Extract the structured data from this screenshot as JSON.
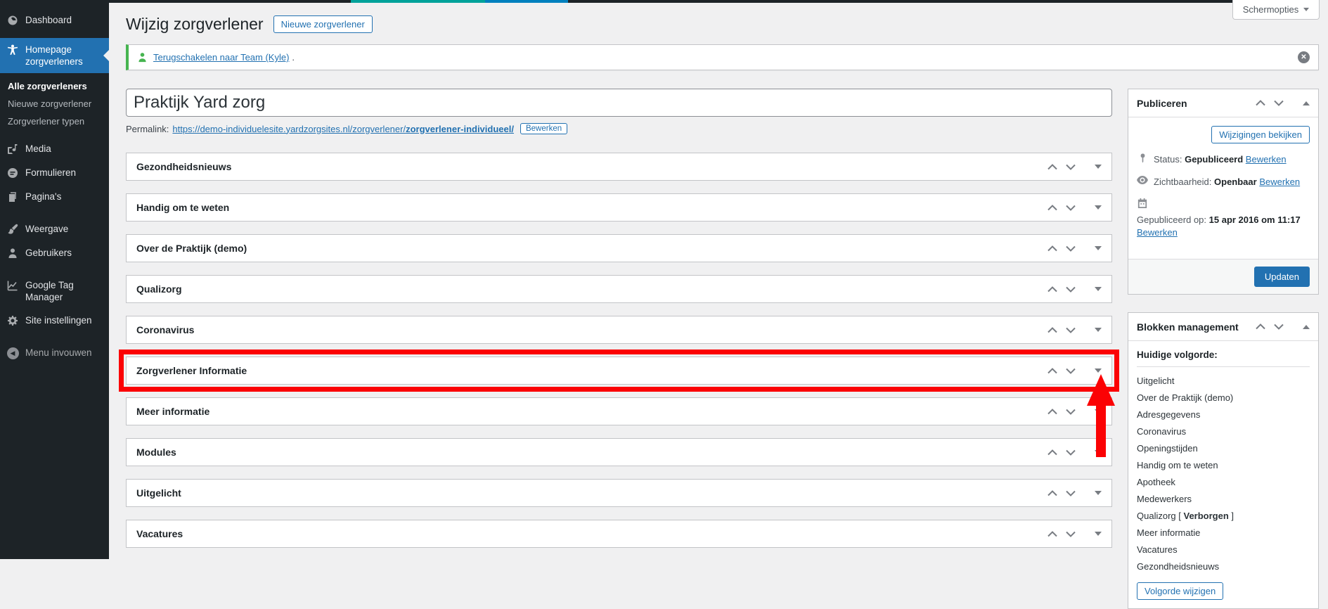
{
  "header": {
    "title": "Wijzig zorgverlener",
    "new_button": "Nieuwe zorgverlener",
    "screen_options": "Schermopties"
  },
  "notice": {
    "link": "Terugschakelen naar Team (Kyle)",
    "period": "."
  },
  "sidebar": {
    "dashboard": {
      "label": "Dashboard",
      "icon": "dashboard-icon"
    },
    "active": {
      "label": "Homepage zorgverleners",
      "icon": "universal-access-icon"
    },
    "submenu": [
      {
        "label": "Alle zorgverleners"
      },
      {
        "label": "Nieuwe zorgverlener"
      },
      {
        "label": "Zorgverlener typen"
      }
    ],
    "items": [
      {
        "label": "Media",
        "icon": "media-icon"
      },
      {
        "label": "Formulieren",
        "icon": "forms-icon"
      },
      {
        "label": "Pagina's",
        "icon": "pages-icon"
      },
      {
        "label": "Weergave",
        "icon": "appearance-icon"
      },
      {
        "label": "Gebruikers",
        "icon": "users-icon"
      },
      {
        "label": "Google Tag Manager",
        "icon": "chart-icon"
      },
      {
        "label": "Site instellingen",
        "icon": "gear-icon"
      },
      {
        "label": "Menu invouwen",
        "icon": "collapse-icon"
      }
    ]
  },
  "editor": {
    "title_value": "Praktijk Yard zorg",
    "permalink_label": "Permalink:",
    "permalink_url": "https://demo-individuelesite.yardzorgsites.nl/zorgverlener/",
    "permalink_slug": "zorgverlener-individueel/",
    "permalink_edit": "Bewerken"
  },
  "metaboxes": [
    {
      "title": "Gezondheidsnieuws",
      "highlighted": false
    },
    {
      "title": "Handig om te weten",
      "highlighted": false
    },
    {
      "title": "Over de Praktijk (demo)",
      "highlighted": false
    },
    {
      "title": "Qualizorg",
      "highlighted": false
    },
    {
      "title": "Coronavirus",
      "highlighted": false
    },
    {
      "title": "Zorgverlener Informatie",
      "highlighted": true
    },
    {
      "title": "Meer informatie",
      "highlighted": false
    },
    {
      "title": "Modules",
      "highlighted": false
    },
    {
      "title": "Uitgelicht",
      "highlighted": false
    },
    {
      "title": "Vacatures",
      "highlighted": false
    }
  ],
  "publish_panel": {
    "title": "Publiceren",
    "preview_button": "Wijzigingen bekijken",
    "rows": [
      {
        "label": "Status:",
        "value": "Gepubliceerd",
        "action": "Bewerken",
        "icon": "pin-icon"
      },
      {
        "label": "Zichtbaarheid:",
        "value": "Openbaar",
        "action": "Bewerken",
        "icon": "eye-icon"
      },
      {
        "label": "Gepubliceerd op:",
        "value": "15 apr 2016 om 11:17",
        "action": "Bewerken",
        "icon": "calendar-icon"
      }
    ],
    "update_button": "Updaten"
  },
  "blocks_panel": {
    "title": "Blokken management",
    "subtitle": "Huidige volgorde:",
    "items": [
      {
        "text": "Uitgelicht"
      },
      {
        "text": "Over de Praktijk (demo)"
      },
      {
        "text": "Adresgegevens"
      },
      {
        "text": "Coronavirus"
      },
      {
        "text": "Openingstijden"
      },
      {
        "text": "Handig om te weten"
      },
      {
        "text": "Apotheek"
      },
      {
        "text": "Medewerkers"
      },
      {
        "text": "Qualizorg [ ",
        "bold": "Verborgen",
        "post": " ]"
      },
      {
        "text": "Meer informatie"
      },
      {
        "text": "Vacatures"
      },
      {
        "text": "Gezondheidsnieuws"
      }
    ],
    "order_button": "Volgorde wijzigen"
  },
  "colors": {
    "accent_blue": "#2271b1",
    "highlight_red": "#fb0204",
    "notice_green": "#46b450",
    "strip_teal": "#00a29a",
    "strip_blue": "#0080be",
    "sidebar_bg": "#1d2327"
  }
}
